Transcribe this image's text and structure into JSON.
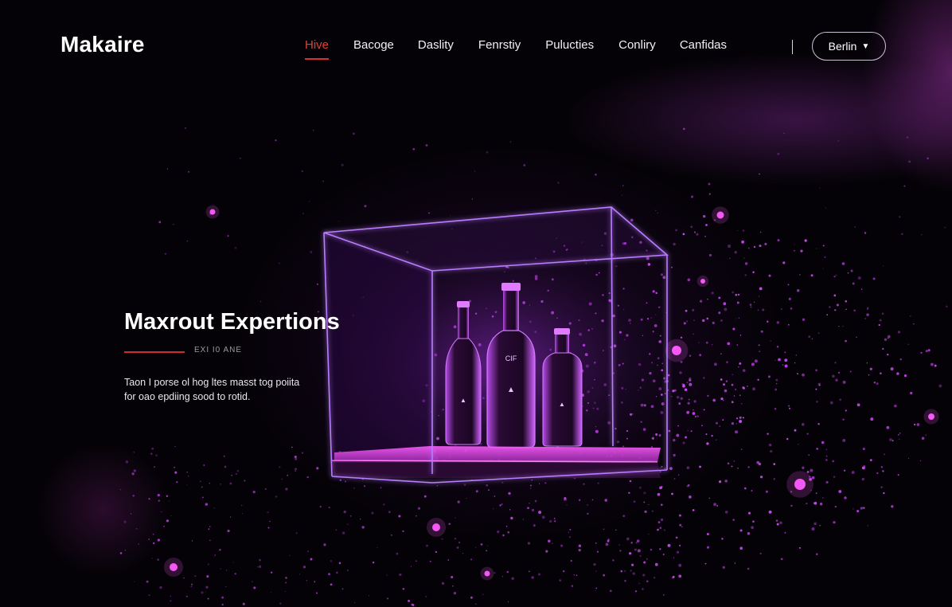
{
  "brand": {
    "name": "Makaire"
  },
  "nav": {
    "items": [
      {
        "label": "Hive",
        "active": true
      },
      {
        "label": "Bacoge",
        "active": false
      },
      {
        "label": "Daslity",
        "active": false
      },
      {
        "label": "Fenrstiy",
        "active": false
      },
      {
        "label": "Pulucties",
        "active": false
      },
      {
        "label": "Conliry",
        "active": false
      },
      {
        "label": "Canfidas",
        "active": false
      }
    ],
    "language_button": {
      "label": "Berlin",
      "icon": "chevron-down-icon"
    }
  },
  "hero": {
    "title": "Maxrout Expertions",
    "tagline": "EXI  I0  ANE",
    "body_lines": [
      "Taon I porse ol hog ltes masst tog poiita",
      "for oao epdiing sood to rotid."
    ]
  },
  "showcase": {
    "bottle_labels": {
      "left": "",
      "center": "CIF",
      "right": ""
    }
  },
  "colors": {
    "accent_red": "#d8302a",
    "glow_purple": "#c23cff",
    "background": "#040206"
  }
}
